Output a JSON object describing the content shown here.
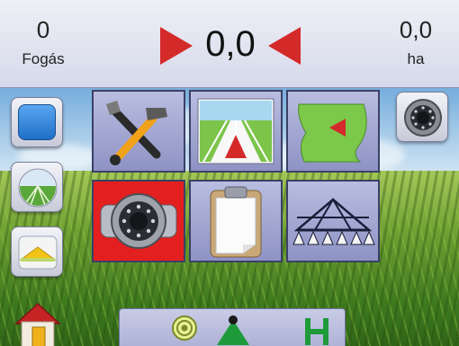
{
  "header": {
    "left": {
      "value": "0",
      "unit": "Fogás"
    },
    "center": {
      "value": "0,0"
    },
    "right": {
      "value": "0,0",
      "unit": "ha"
    }
  },
  "colors": {
    "arrow_red": "#d42a2a",
    "tile_purple": "#9a9fd0",
    "camera_tile_red": "#e41f1f",
    "guidance_green": "#1f9a3a",
    "header_bg": "#dfe1ee"
  },
  "left_sidebar": [
    {
      "icon": "blank-screen-icon"
    },
    {
      "icon": "straight-guidance-icon"
    },
    {
      "icon": "last-pass-guidance-icon"
    },
    {
      "icon": "home-icon"
    }
  ],
  "grid_tiles": [
    {
      "icon": "tools-icon"
    },
    {
      "icon": "vehicle-view-icon"
    },
    {
      "icon": "field-map-icon"
    },
    {
      "icon": "camera-icon"
    },
    {
      "icon": "report-clipboard-icon"
    },
    {
      "icon": "boom-section-icon"
    }
  ],
  "right_sidebar": [
    {
      "icon": "camera-icon"
    }
  ],
  "bottom_bar": [
    {
      "icon": "gps-status-icon"
    },
    {
      "icon": "vehicle-guidance-icon"
    },
    {
      "icon": "boom-status-icon"
    }
  ]
}
